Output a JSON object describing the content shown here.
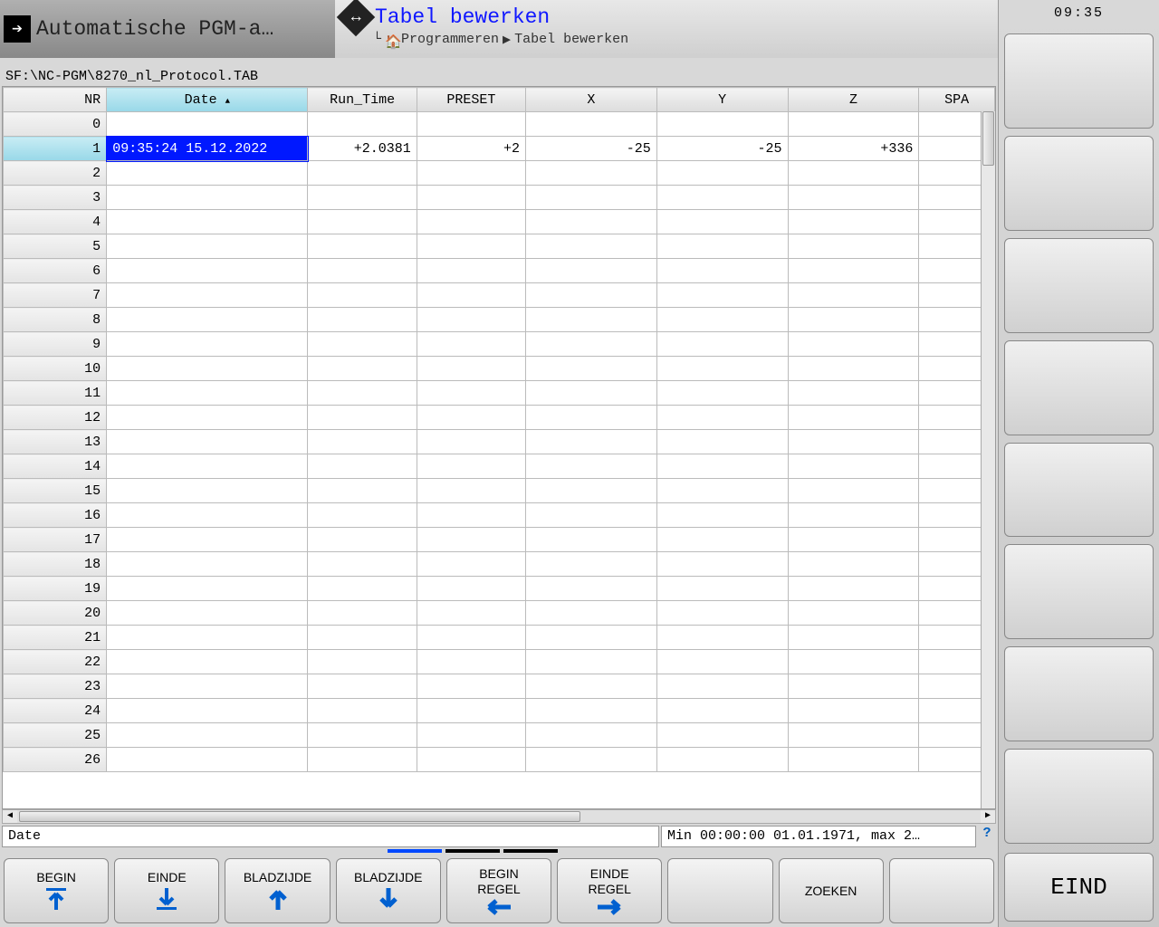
{
  "clock": "09:35",
  "header": {
    "left_title": "Automatische PGM-a…",
    "right_title": "Tabel bewerken",
    "breadcrumb": [
      "Programmeren",
      "Tabel bewerken"
    ]
  },
  "file_path": "SF:\\NC-PGM\\8270_nl_Protocol.TAB",
  "table": {
    "columns": [
      "NR",
      "Date",
      "Run_Time",
      "PRESET",
      "X",
      "Y",
      "Z",
      "SPA"
    ],
    "sorted_column": "Date",
    "active_row": 1,
    "selected_cell": {
      "row": 1,
      "col": "Date"
    },
    "rows": [
      {
        "nr": 0,
        "Date": "",
        "Run_Time": "",
        "PRESET": "",
        "X": "",
        "Y": "",
        "Z": "",
        "SPA": ""
      },
      {
        "nr": 1,
        "Date": "09:35:24 15.12.2022",
        "Run_Time": "+2.0381",
        "PRESET": "+2",
        "X": "-25",
        "Y": "-25",
        "Z": "+336",
        "SPA": ""
      },
      {
        "nr": 2
      },
      {
        "nr": 3
      },
      {
        "nr": 4
      },
      {
        "nr": 5
      },
      {
        "nr": 6
      },
      {
        "nr": 7
      },
      {
        "nr": 8
      },
      {
        "nr": 9
      },
      {
        "nr": 10
      },
      {
        "nr": 11
      },
      {
        "nr": 12
      },
      {
        "nr": 13
      },
      {
        "nr": 14
      },
      {
        "nr": 15
      },
      {
        "nr": 16
      },
      {
        "nr": 17
      },
      {
        "nr": 18
      },
      {
        "nr": 19
      },
      {
        "nr": 20
      },
      {
        "nr": 21
      },
      {
        "nr": 22
      },
      {
        "nr": 23
      },
      {
        "nr": 24
      },
      {
        "nr": 25
      },
      {
        "nr": 26
      }
    ]
  },
  "status": {
    "field_name": "Date",
    "range_text": "Min 00:00:00 01.01.1971, max 2…"
  },
  "softkeys": {
    "k1": "BEGIN",
    "k2": "EINDE",
    "k3": "BLADZIJDE",
    "k4": "BLADZIJDE",
    "k5_line1": "BEGIN",
    "k5_line2": "REGEL",
    "k6_line1": "EINDE",
    "k6_line2": "REGEL",
    "k7": "",
    "k8": "ZOEKEN",
    "k9": ""
  },
  "side_button": "EIND"
}
